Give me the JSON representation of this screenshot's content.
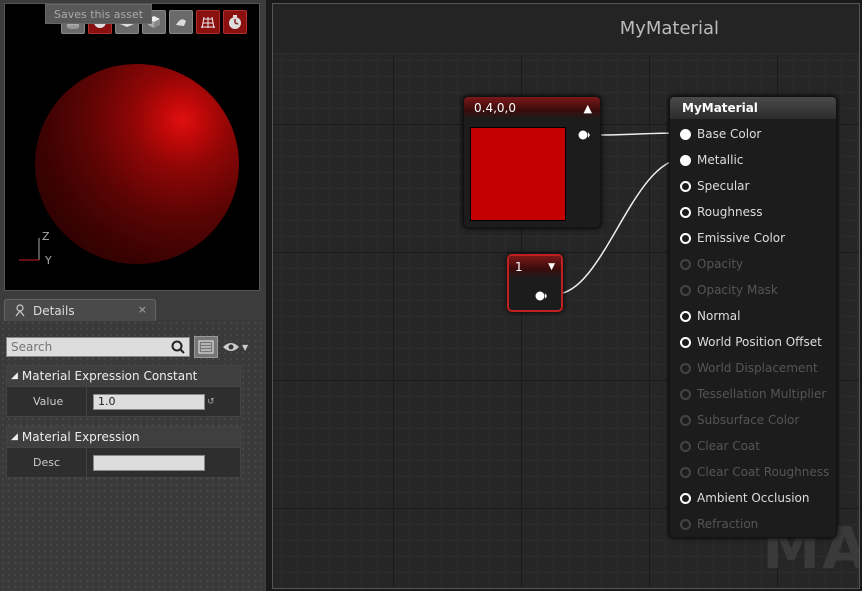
{
  "viewport": {
    "tooltip": "Saves this asset",
    "axis": {
      "z": "Z",
      "y": "Y"
    }
  },
  "details": {
    "tab_label": "Details",
    "close": "×",
    "search_placeholder": "Search",
    "sections": [
      {
        "title": "Material Expression Constant",
        "rows": [
          {
            "label": "Value",
            "value": "1.0"
          }
        ]
      },
      {
        "title": "Material Expression",
        "rows": [
          {
            "label": "Desc",
            "value": ""
          }
        ]
      }
    ]
  },
  "graph": {
    "title": "MyMaterial",
    "watermark": "MA",
    "nodes": {
      "constant3": {
        "label": "0.4,0,0",
        "color": "#c40000"
      },
      "constant1": {
        "label": "1"
      },
      "result": {
        "title": "MyMaterial",
        "pins": [
          {
            "label": "Base Color",
            "enabled": true,
            "connected": true
          },
          {
            "label": "Metallic",
            "enabled": true,
            "connected": true
          },
          {
            "label": "Specular",
            "enabled": true,
            "connected": false
          },
          {
            "label": "Roughness",
            "enabled": true,
            "connected": false
          },
          {
            "label": "Emissive Color",
            "enabled": true,
            "connected": false
          },
          {
            "label": "Opacity",
            "enabled": false,
            "connected": false
          },
          {
            "label": "Opacity Mask",
            "enabled": false,
            "connected": false
          },
          {
            "label": "Normal",
            "enabled": true,
            "connected": false
          },
          {
            "label": "World Position Offset",
            "enabled": true,
            "connected": false
          },
          {
            "label": "World Displacement",
            "enabled": false,
            "connected": false
          },
          {
            "label": "Tessellation Multiplier",
            "enabled": false,
            "connected": false
          },
          {
            "label": "Subsurface Color",
            "enabled": false,
            "connected": false
          },
          {
            "label": "Clear Coat",
            "enabled": false,
            "connected": false
          },
          {
            "label": "Clear Coat Roughness",
            "enabled": false,
            "connected": false
          },
          {
            "label": "Ambient Occlusion",
            "enabled": true,
            "connected": false
          },
          {
            "label": "Refraction",
            "enabled": false,
            "connected": false
          }
        ]
      }
    }
  }
}
